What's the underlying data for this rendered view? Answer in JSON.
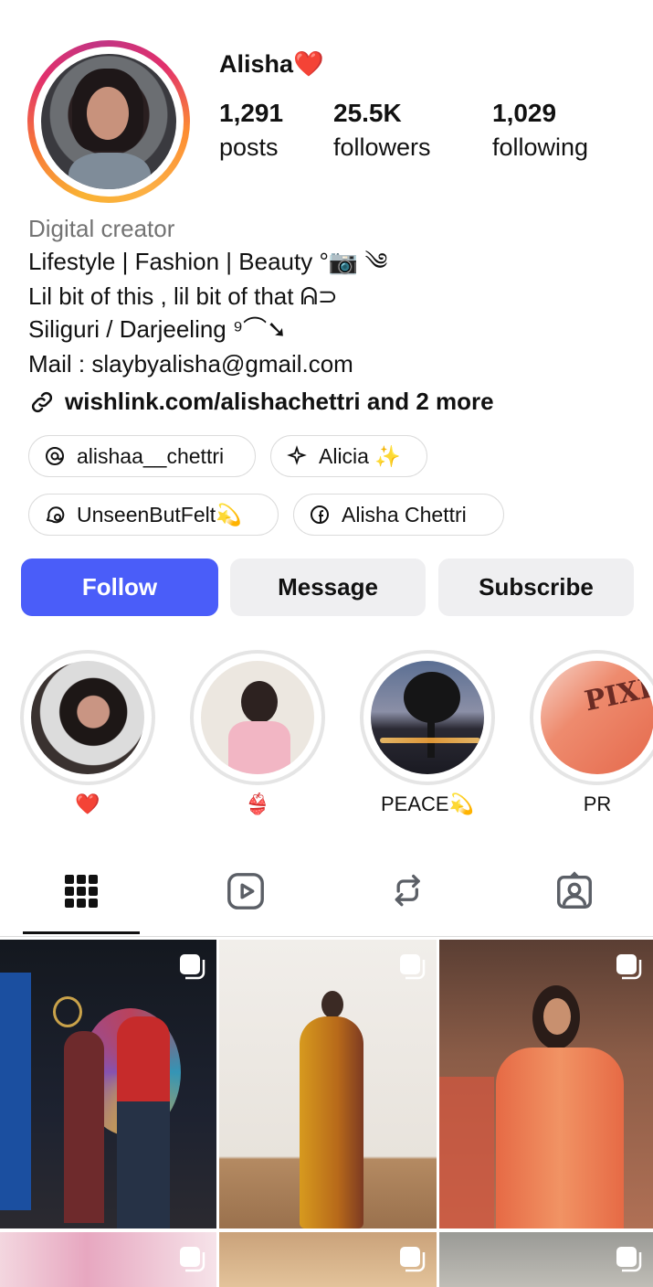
{
  "profile": {
    "username": "Alisha❤️",
    "stats": [
      {
        "value": "1,291",
        "label": "posts"
      },
      {
        "value": "25.5K",
        "label": "followers"
      },
      {
        "value": "1,029",
        "label": "following"
      }
    ],
    "category": "Digital creator",
    "bio_lines": [
      "Lifestyle | Fashion | Beauty °📷 ༄",
      "Lil bit of this , lil bit of that ᕱ⊃",
      "Siliguri / Darjeeling ⁹⌒➘",
      "Mail : slaybyalisha@gmail.com"
    ],
    "link_text": "wishlink.com/alishachettri and 2 more"
  },
  "chips": [
    {
      "label": "alishaa__chettri",
      "icon": "threads-icon"
    },
    {
      "label": "Alicia ✨",
      "icon": "sparkle-icon"
    },
    {
      "label": "UnseenButFelt💫",
      "icon": "chat-bubble-icon"
    },
    {
      "label": "Alisha Chettri",
      "icon": "facebook-icon"
    }
  ],
  "actions": {
    "follow": "Follow",
    "message": "Message",
    "subscribe": "Subscribe"
  },
  "highlights": [
    {
      "label": "❤️"
    },
    {
      "label": "👙"
    },
    {
      "label": "PEACE💫"
    },
    {
      "label": "PR"
    }
  ],
  "highlight_pixi_text": "PIXI",
  "tabs": [
    {
      "name": "grid-icon"
    },
    {
      "name": "reels-icon"
    },
    {
      "name": "reposts-icon"
    },
    {
      "name": "tagged-icon"
    }
  ],
  "colors": {
    "follow_button": "#4a5df9",
    "secondary_button": "#efeff1",
    "muted_text": "#737373"
  }
}
